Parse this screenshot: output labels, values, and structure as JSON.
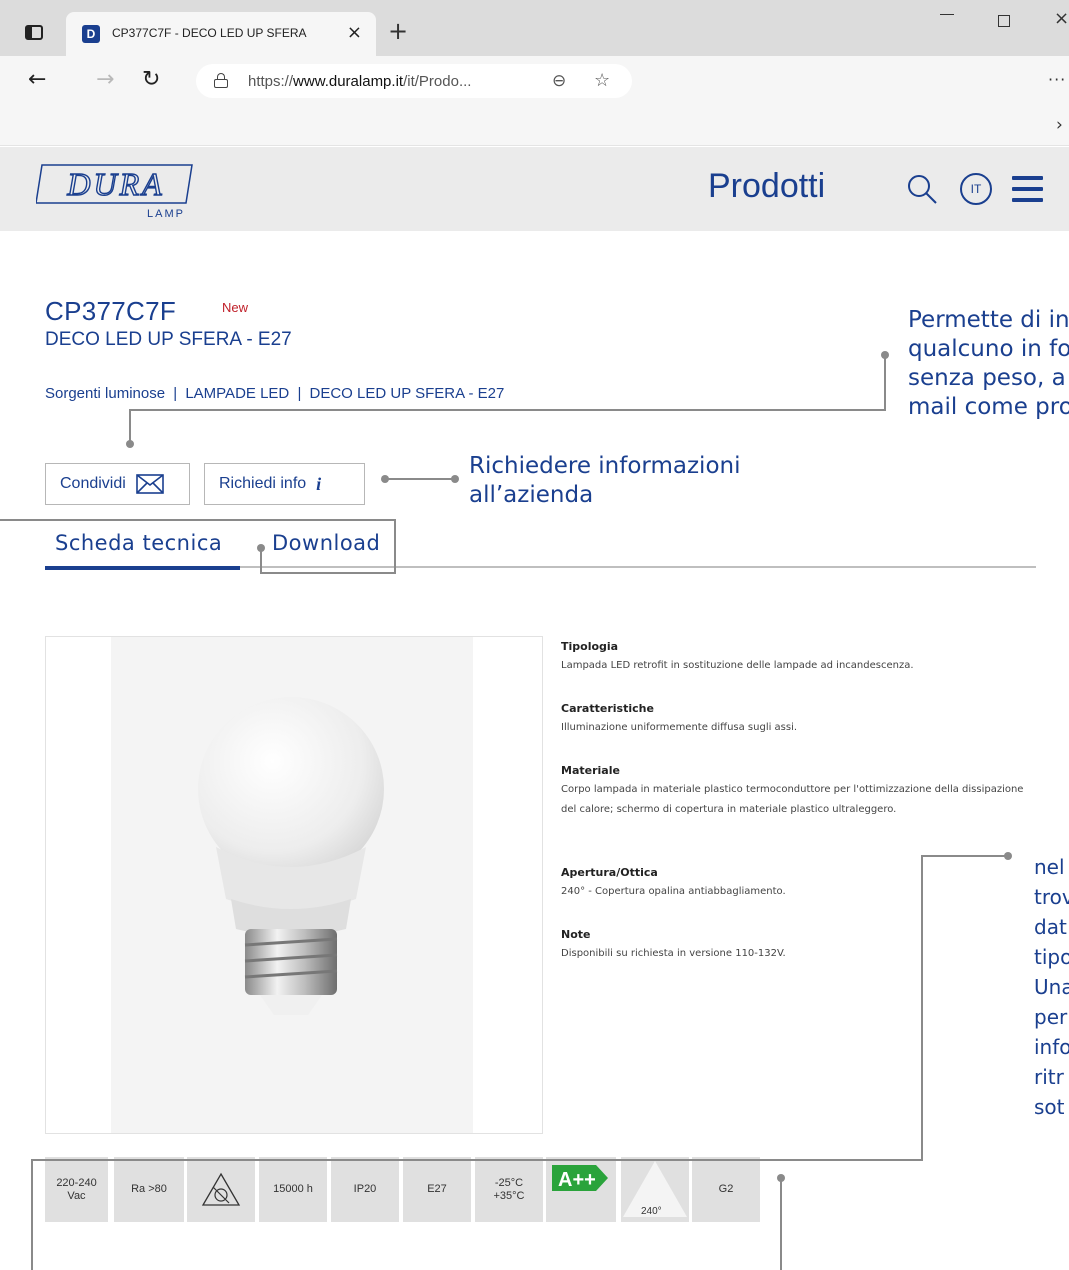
{
  "browser": {
    "tab_title": "CP377C7F - DECO LED UP SFERA",
    "tab_close": "×",
    "new_tab": "+",
    "url_prefix": "https://",
    "url_domain": "www.duralamp.it",
    "url_path": "/it/Prodo...",
    "more": "···",
    "favbar_chevron": "›"
  },
  "header": {
    "logo_top": "DURA",
    "logo_bottom": "LAMP",
    "nav_label": "Prodotti",
    "language": "IT"
  },
  "product": {
    "code": "CP377C7F",
    "badge": "New",
    "name": "DECO LED UP SFERA - E27",
    "breadcrumb": [
      "Sorgenti luminose",
      "LAMPADE LED",
      "DECO LED UP SFERA - E27"
    ],
    "breadcrumb_sep": "|"
  },
  "actions": {
    "share_label": "Condividi",
    "info_label": "Richiedi info",
    "info_icon": "i"
  },
  "tabs": {
    "tech": "Scheda tecnica",
    "download": "Download"
  },
  "specs": [
    {
      "title": "Tipologia",
      "text": "Lampada LED retrofit in sostituzione delle lampade ad incandescenza."
    },
    {
      "title": "Caratteristiche",
      "text": "Illuminazione uniformemente diffusa sugli assi."
    },
    {
      "title": "Materiale",
      "text": "Corpo lampada in materiale plastico termoconduttore per l'ottimizzazione della dissipazione del calore; schermo di copertura in materiale plastico ultraleggero."
    },
    {
      "title": "Apertura/Ottica",
      "text": "240° - Copertura opalina antiabbagliamento."
    },
    {
      "title": "Note",
      "text": "Disponibili su richiesta in versione 110-132V."
    }
  ],
  "features": {
    "voltage": "220-240 Vac",
    "ra": "Ra >80",
    "lifetime": "15000 h",
    "ip": "IP20",
    "socket": "E27",
    "temp": "-25°C +35°C",
    "energy": "A++",
    "angle": "240°",
    "group": "G2"
  },
  "annotations": {
    "share_lines": [
      "Permette di in",
      "qualcuno in fo",
      "senza peso, a",
      "mail come pro"
    ],
    "info_lines": [
      "Richiedere informazioni",
      "all’azienda"
    ],
    "side_lines": [
      "nel",
      "trov",
      "dat",
      "tipo",
      "Una",
      "per",
      "info",
      "ritr",
      "sot"
    ]
  },
  "colors": {
    "brand": "#1a3f8f",
    "new_badge": "#c0202a",
    "energy_green": "#2aa33b"
  }
}
